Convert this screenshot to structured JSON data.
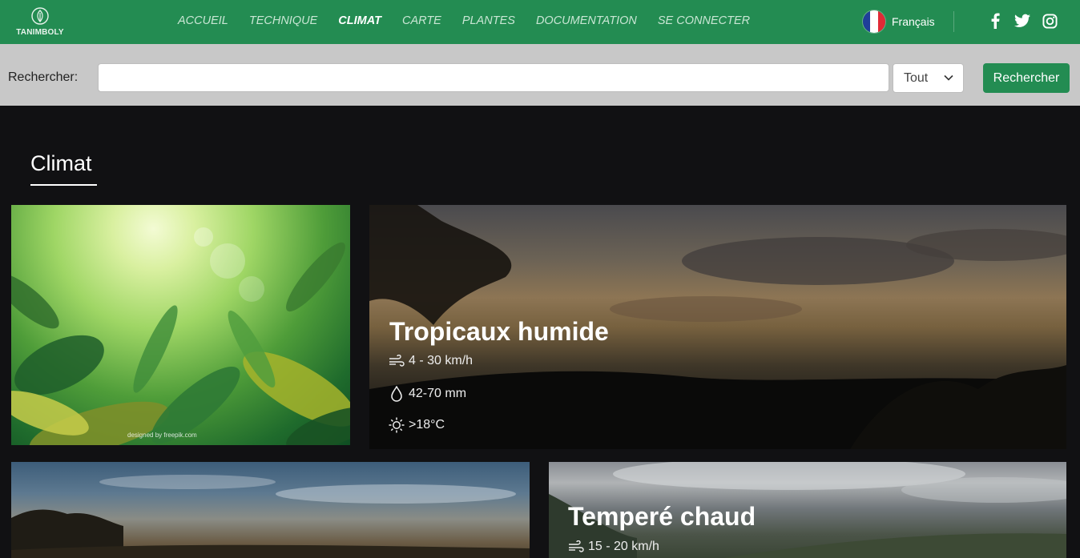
{
  "header": {
    "logo_text": "TANIMBOLY",
    "nav": [
      {
        "label": "ACCUEIL",
        "active": false
      },
      {
        "label": "TECHNIQUE",
        "active": false
      },
      {
        "label": "CLIMAT",
        "active": true
      },
      {
        "label": "CARTE",
        "active": false
      },
      {
        "label": "PLANTES",
        "active": false
      },
      {
        "label": "DOCUMENTATION",
        "active": false
      },
      {
        "label": "SE CONNECTER",
        "active": false
      }
    ],
    "language": "Français",
    "socials": [
      "facebook-icon",
      "twitter-icon",
      "instagram-icon"
    ],
    "brand_color": "#238c52"
  },
  "search": {
    "label": "Rechercher:",
    "value": "",
    "placeholder": "",
    "filter_selected": "Tout",
    "button_label": "Rechercher"
  },
  "section": {
    "title": "Climat"
  },
  "cards": [
    {
      "title": "",
      "image_caption": "designed by freepik.com"
    },
    {
      "title": "Tropicaux humide",
      "wind": "4 - 30 km/h",
      "rain": "42-70 mm",
      "temperature": ">18°C"
    },
    {
      "title": ""
    },
    {
      "title": "Temperé chaud",
      "wind": "15 - 20 km/h"
    }
  ]
}
